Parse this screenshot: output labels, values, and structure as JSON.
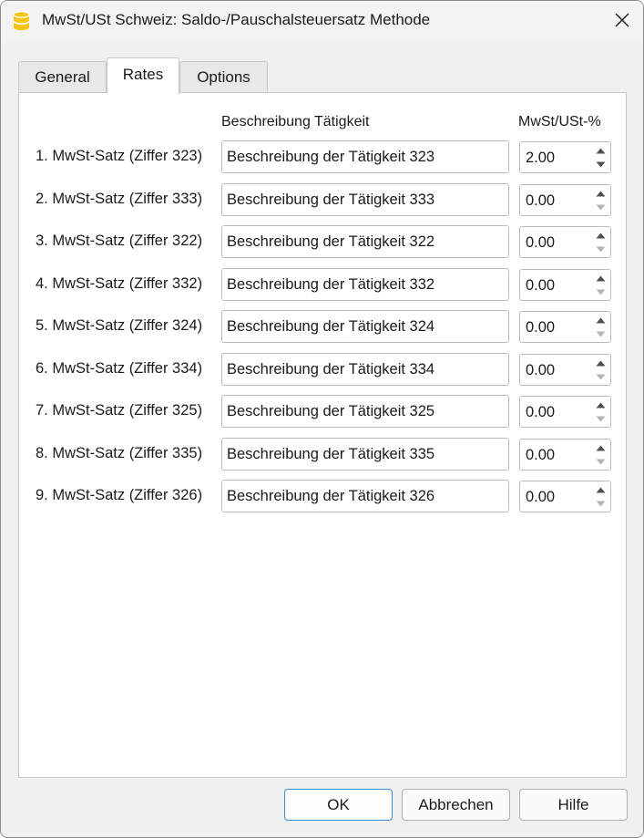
{
  "window": {
    "title": "MwSt/USt Schweiz: Saldo-/Pauschalsteuersatz Methode",
    "app_icon": "banana-database-icon",
    "close_icon": "close-icon"
  },
  "tabs": [
    {
      "label": "General",
      "active": false
    },
    {
      "label": "Rates",
      "active": true
    },
    {
      "label": "Options",
      "active": false
    }
  ],
  "table": {
    "header_description": "Beschreibung Tätigkeit",
    "header_rate": "MwSt/USt-%",
    "rows": [
      {
        "label": "1. MwSt-Satz (Ziffer 323)",
        "description": "Beschreibung der Tätigkeit 323",
        "rate": "2.00",
        "up_enabled": true,
        "down_enabled": true
      },
      {
        "label": "2. MwSt-Satz (Ziffer 333)",
        "description": "Beschreibung der Tätigkeit 333",
        "rate": "0.00",
        "up_enabled": true,
        "down_enabled": false
      },
      {
        "label": "3. MwSt-Satz (Ziffer 322)",
        "description": "Beschreibung der Tätigkeit 322",
        "rate": "0.00",
        "up_enabled": true,
        "down_enabled": false
      },
      {
        "label": "4. MwSt-Satz (Ziffer 332)",
        "description": "Beschreibung der Tätigkeit 332",
        "rate": "0.00",
        "up_enabled": true,
        "down_enabled": false
      },
      {
        "label": "5. MwSt-Satz (Ziffer 324)",
        "description": "Beschreibung der Tätigkeit 324",
        "rate": "0.00",
        "up_enabled": true,
        "down_enabled": false
      },
      {
        "label": "6. MwSt-Satz (Ziffer 334)",
        "description": "Beschreibung der Tätigkeit 334",
        "rate": "0.00",
        "up_enabled": true,
        "down_enabled": false
      },
      {
        "label": "7. MwSt-Satz (Ziffer 325)",
        "description": "Beschreibung der Tätigkeit 325",
        "rate": "0.00",
        "up_enabled": true,
        "down_enabled": false
      },
      {
        "label": "8. MwSt-Satz (Ziffer 335)",
        "description": "Beschreibung der Tätigkeit 335",
        "rate": "0.00",
        "up_enabled": true,
        "down_enabled": false
      },
      {
        "label": "9. MwSt-Satz (Ziffer 326)",
        "description": "Beschreibung der Tätigkeit 326",
        "rate": "0.00",
        "up_enabled": true,
        "down_enabled": false
      }
    ]
  },
  "footer": {
    "ok_label": "OK",
    "cancel_label": "Abbrechen",
    "help_label": "Hilfe"
  },
  "colors": {
    "window_bg": "#f0f0f0",
    "panel_bg": "#ffffff",
    "border": "#bcbcbc",
    "primary_button_border": "#3a8ad6",
    "app_icon_yellow": "#f5c518",
    "spin_arrow_enabled": "#505050",
    "spin_arrow_disabled": "#b4b4b4"
  }
}
